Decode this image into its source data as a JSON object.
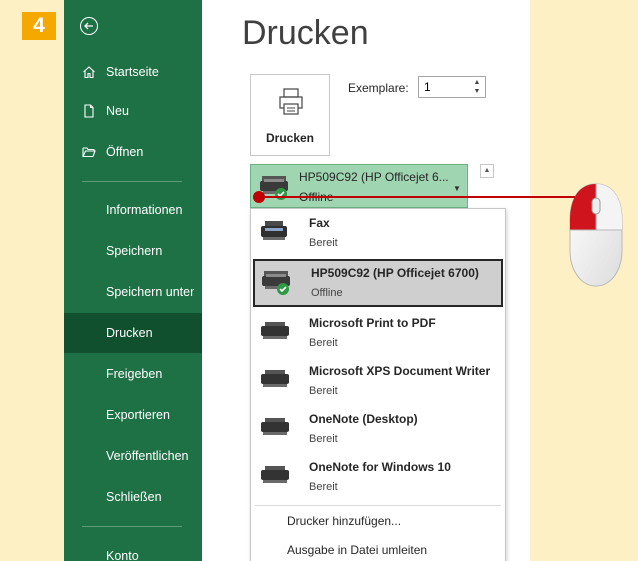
{
  "step_number": "4",
  "sidebar": {
    "items": [
      {
        "label": "Startseite",
        "icon": "home-icon"
      },
      {
        "label": "Neu",
        "icon": "new-document-icon"
      },
      {
        "label": "Öffnen",
        "icon": "open-folder-icon"
      },
      {
        "label": "Informationen"
      },
      {
        "label": "Speichern"
      },
      {
        "label": "Speichern unter"
      },
      {
        "label": "Drucken",
        "active": true
      },
      {
        "label": "Freigeben"
      },
      {
        "label": "Exportieren"
      },
      {
        "label": "Veröffentlichen"
      },
      {
        "label": "Schließen"
      },
      {
        "label": "Konto"
      }
    ]
  },
  "main": {
    "title": "Drucken",
    "print_button_label": "Drucken",
    "copies_label": "Exemplare:",
    "copies_value": "1",
    "selected_printer": {
      "name": "HP509C92 (HP Officejet 6...",
      "status": "Offline"
    }
  },
  "printer_list": [
    {
      "name": "Fax",
      "status": "Bereit",
      "icon": "fax-icon"
    },
    {
      "name": "HP509C92 (HP Officejet 6700)",
      "status": "Offline",
      "icon": "printer-icon"
    },
    {
      "name": "Microsoft Print to PDF",
      "status": "Bereit",
      "icon": "printer-icon"
    },
    {
      "name": "Microsoft XPS Document Writer",
      "status": "Bereit",
      "icon": "printer-icon"
    },
    {
      "name": "OneNote (Desktop)",
      "status": "Bereit",
      "icon": "printer-icon"
    },
    {
      "name": "OneNote for Windows 10",
      "status": "Bereit",
      "icon": "printer-icon"
    }
  ],
  "dropdown_actions": {
    "add_printer": "Drucker hinzufügen...",
    "print_to_file": "Ausgabe in Datei umleiten"
  },
  "colors": {
    "sidebar": "#1e7145",
    "sidebar_active": "#10502f",
    "selected_printer_bg": "#9fd5b1",
    "step_badge": "#f5a800",
    "callout_red": "#c00000",
    "background": "#fdf0c4"
  }
}
